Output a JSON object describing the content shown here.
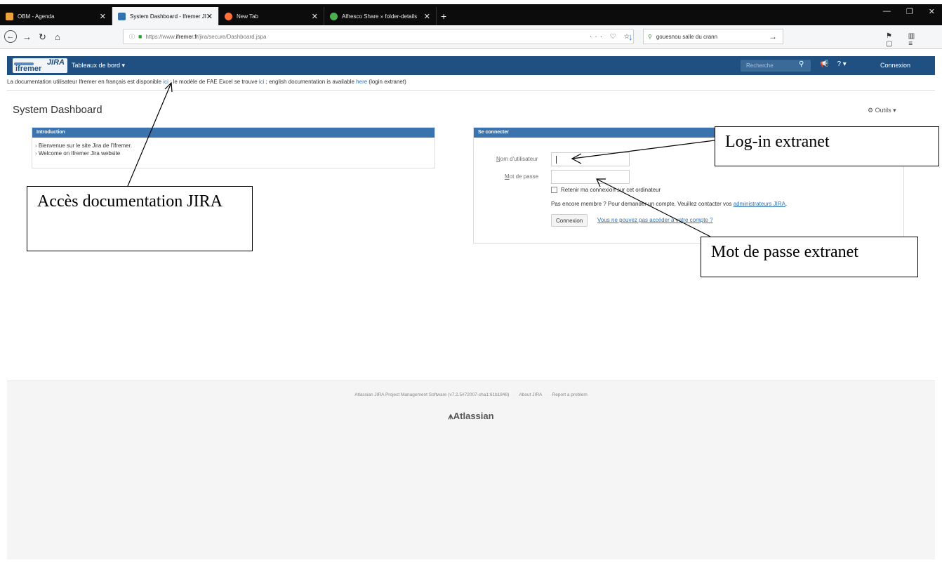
{
  "browser": {
    "tabs": [
      {
        "title": "OBM - Agenda",
        "favicon": "calendar-icon",
        "color": "#e8a33d"
      },
      {
        "title": "System Dashboard - Ifremer JI",
        "favicon": "jira-icon",
        "color": "#3572b0"
      },
      {
        "title": "New Tab",
        "favicon": "firefox-icon",
        "color": "#ff7139"
      },
      {
        "title": "Alfresco Share » folder-details",
        "favicon": "alfresco-icon",
        "color": "#4caf50"
      }
    ],
    "url_prefix": "https://www.",
    "url_host": "ifremer.fr",
    "url_path": "/jira/secure/Dashboard.jspa",
    "search_value": "gouesnou salle du crann"
  },
  "jira": {
    "logo_top": "JIRA",
    "logo_bottom": "ifremer",
    "menu_dashboards": "Tableaux de bord ▾",
    "search_placeholder": "Recherche",
    "login_link": "Connexion",
    "announcement": {
      "part1": "La documentation utilisateur Ifremer en français est disponible ",
      "link1": "ici",
      "part2": " ; le modèle de FAE Excel se trouve ",
      "link2": "ici",
      "part3": " ; english documentation is available ",
      "link3": "here",
      "part4": " (login extranet)"
    },
    "page_title": "System Dashboard",
    "tools": "Outils ▾",
    "intro": {
      "title": "Introduction",
      "items": [
        "Bienvenue sur le site Jira de l'Ifremer.",
        "Welcome on Ifremer Jira website"
      ]
    },
    "login": {
      "title": "Se connecter",
      "username_label_u": "N",
      "username_label_rest": "om d'utilisateur",
      "password_label_u": "M",
      "password_label_rest": "ot de passe",
      "remember": "Retenir ma connexion sur cet ordinateur",
      "register_text": "Pas encore membre ? Pour demander un compte, Veuillez contacter vos ",
      "register_link": "administrateurs JIRA",
      "register_end": ".",
      "button": "Connexion",
      "forgot": "Vous ne pouvez pas accéder à votre compte ?"
    },
    "footer": {
      "software": "Atlassian JIRA Project Management Software (v7.2.5#72007-sha1:61b1848)",
      "about": "About JIRA",
      "report": "Report a problem",
      "brand": "Atlassian"
    }
  },
  "annotations": {
    "doc": "Accès documentation JIRA",
    "login": "Log-in extranet",
    "password": "Mot de passe extranet"
  }
}
